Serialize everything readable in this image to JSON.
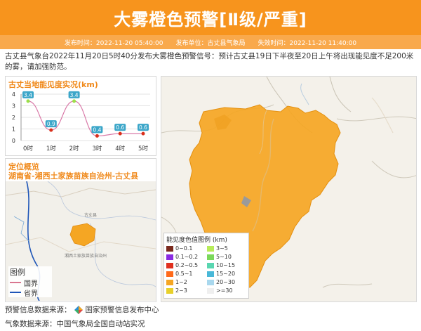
{
  "header": {
    "title": "大雾橙色预警[Ⅱ级/严重]",
    "issue_time": "发布时间：2022-11-20 05:40:00",
    "issuer": "发布单位：古丈县气象局",
    "expire_time": "失效时间：2022-11-20 11:40:00"
  },
  "description": "古丈县气象台2022年11月20日5时40分发布大雾橙色预警信号：预计古丈县19日下半夜至20日上午将出现能见度不足200米的雾，请加强防范。",
  "visibility_panel": {
    "title": "古丈当地能见度实况(km)",
    "y_ticks": [
      "4",
      "3",
      "2",
      "1",
      "0"
    ]
  },
  "chart_data": {
    "type": "line",
    "title": "古丈当地能见度实况(km)",
    "categories": [
      "0时",
      "1时",
      "2时",
      "3时",
      "4时",
      "5时"
    ],
    "values": [
      3.4,
      0.9,
      3.4,
      0.4,
      0.6,
      0.6
    ],
    "ylim": [
      0,
      4
    ],
    "grid": true,
    "colors": {
      "line": "#d97aa8",
      "label_bg": "#3ba6c9",
      "point_high": "#9be04a",
      "point_low": "#d9301b"
    }
  },
  "locate_panel": {
    "title": "定位概览",
    "region": "湖南省-湘西土家族苗族自治州-古丈县",
    "legend_title": "图例",
    "legend_items": [
      {
        "label": "国界",
        "color": "#d9768f"
      },
      {
        "label": "省界",
        "color": "#1f56b8"
      }
    ],
    "map_labels": [
      "古丈县",
      "湘西土家族苗族自治州"
    ]
  },
  "visibility_legend": {
    "title": "能见度色值图例 (km)",
    "items": [
      {
        "label": "0~0.1",
        "color": "#7a2a1e"
      },
      {
        "label": "3~5",
        "color": "#b7ec5a"
      },
      {
        "label": "0.1~0.2",
        "color": "#8a2be2"
      },
      {
        "label": "5~10",
        "color": "#7bd85a"
      },
      {
        "label": "0.2~0.5",
        "color": "#e0301e"
      },
      {
        "label": "10~15",
        "color": "#59d6b0"
      },
      {
        "label": "0.5~1",
        "color": "#ff6a1a"
      },
      {
        "label": "15~20",
        "color": "#49b8d8"
      },
      {
        "label": "1~2",
        "color": "#f5a623"
      },
      {
        "label": "20~30",
        "color": "#a9d8ee"
      },
      {
        "label": "2~3",
        "color": "#e8d02a"
      },
      {
        "label": ">=30",
        "color": "#efefef"
      }
    ]
  },
  "footer": {
    "warning_source": "预警信息数据来源：",
    "warning_source_name": "国家预警信息发布中心",
    "weather_source": "气象数据来源：中国气象局全国自动站实况"
  },
  "colors": {
    "header": "#f7941d",
    "subbar": "#f9a94c",
    "panel_title": "#f08a1c",
    "fog_area": "#f5a623"
  }
}
